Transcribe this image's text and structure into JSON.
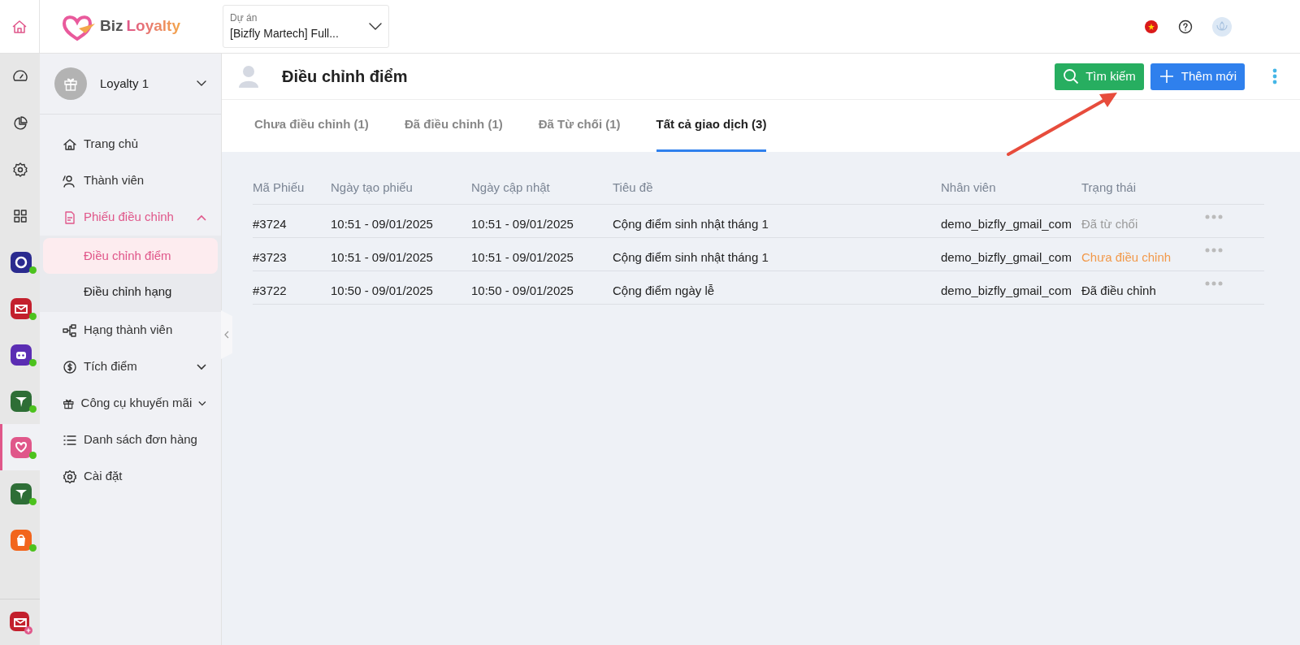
{
  "logo": {
    "part1": "Biz",
    "part2": "Loyalty"
  },
  "project": {
    "label": "Dự án",
    "value": "[Bizfly Martech] Full..."
  },
  "rail": {
    "tools": [
      {
        "selected": false
      },
      {
        "selected": false
      },
      {
        "selected": false
      },
      {
        "selected": false
      }
    ],
    "apps": [
      {
        "color": "#2b2b8f",
        "selected": false,
        "online": true
      },
      {
        "color": "#c3202d",
        "selected": false,
        "online": true
      },
      {
        "color": "#5b2db3",
        "selected": false,
        "online": true
      },
      {
        "color": "#2e6e36",
        "selected": false,
        "online": true
      },
      {
        "color": "#e0578a",
        "selected": true,
        "online": true
      },
      {
        "color": "#2e6e36",
        "selected": false,
        "online": true
      },
      {
        "color": "#f2651c",
        "selected": false,
        "online": true
      }
    ],
    "bottom_app": {
      "color": "#c3202d"
    }
  },
  "account": {
    "name": "Loyalty 1"
  },
  "menu": [
    {
      "label": "Trang chủ"
    },
    {
      "label": "Thành viên"
    },
    {
      "label": "Phiếu điều chỉnh",
      "expanded": true,
      "children": [
        {
          "label": "Điều chỉnh điểm",
          "selected": true
        },
        {
          "label": "Điều chỉnh hạng",
          "selected": false
        }
      ]
    },
    {
      "label": "Hạng thành viên"
    },
    {
      "label": "Tích điểm",
      "expanded": false
    },
    {
      "label": "Công cụ khuyến mãi",
      "expanded": false
    },
    {
      "label": "Danh sách đơn hàng"
    },
    {
      "label": "Cài đặt"
    }
  ],
  "page": {
    "title": "Điều chỉnh điểm",
    "search_button": "Tìm kiếm",
    "add_button": "Thêm mới"
  },
  "tabs": [
    {
      "label": "Chưa điều chỉnh (1)",
      "selected": false
    },
    {
      "label": "Đã điều chỉnh (1)",
      "selected": false
    },
    {
      "label": "Đã Từ chối (1)",
      "selected": false
    },
    {
      "label": "Tất cả giao dịch (3)",
      "selected": true
    }
  ],
  "table": {
    "columns": [
      "Mã Phiếu",
      "Ngày tạo phiếu",
      "Ngày cập nhật",
      "Tiêu đề",
      "Nhân viên",
      "Trạng thái"
    ],
    "rows": [
      {
        "id": "#3724",
        "created": "10:51 - 09/01/2025",
        "updated": "10:51 - 09/01/2025",
        "title": "Cộng điểm sinh nhật tháng 1",
        "staff": "demo_bizfly_gmail_com",
        "status": "Đã từ chối",
        "kind": "rejected"
      },
      {
        "id": "#3723",
        "created": "10:51 - 09/01/2025",
        "updated": "10:51 - 09/01/2025",
        "title": "Cộng điểm sinh nhật tháng 1",
        "staff": "demo_bizfly_gmail_com",
        "status": "Chưa điều chỉnh",
        "kind": "pending"
      },
      {
        "id": "#3722",
        "created": "10:50 - 09/01/2025",
        "updated": "10:50 - 09/01/2025",
        "title": "Cộng điểm ngày lễ",
        "staff": "demo_bizfly_gmail_com",
        "status": "Đã điều chỉnh",
        "kind": "done"
      }
    ]
  }
}
